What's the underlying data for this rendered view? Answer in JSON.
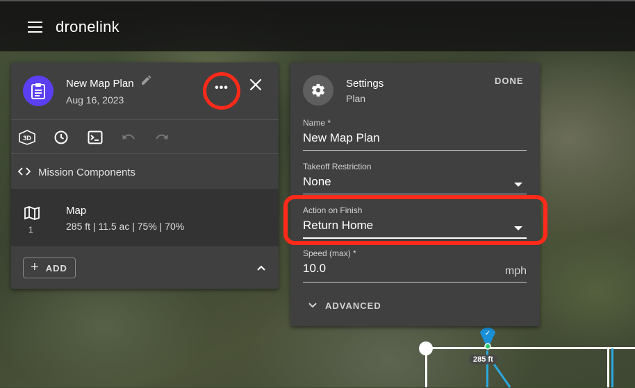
{
  "app": {
    "brand": "dronelink"
  },
  "plan_panel": {
    "title": "New Map Plan",
    "date": "Aug 16, 2023",
    "more_label": "•••",
    "components_label": "Mission Components",
    "component": {
      "title": "Map",
      "details": "285 ft | 11.5 ac | 75% | 70%",
      "count": "1"
    },
    "add_label": "ADD",
    "toolbar_3d_label": "3D"
  },
  "settings_panel": {
    "title": "Settings",
    "subtitle": "Plan",
    "done_label": "DONE",
    "fields": {
      "name": {
        "label": "Name *",
        "value": "New Map Plan"
      },
      "takeoff": {
        "label": "Takeoff Restriction",
        "value": "None"
      },
      "action": {
        "label": "Action on Finish",
        "value": "Return Home"
      },
      "speed": {
        "label": "Speed (max) *",
        "value": "10.0",
        "unit": "mph"
      }
    },
    "advanced_label": "ADVANCED"
  },
  "map": {
    "distance_badge": "285 ft"
  },
  "colors": {
    "accent_purple": "#5b3ff2",
    "highlight_red": "#ff2a1a",
    "panel_bg": "#404040",
    "route_blue": "#2aa9e0"
  },
  "icons": [
    "menu-icon",
    "edit-icon",
    "more-icon",
    "close-icon",
    "3d-view-icon",
    "history-icon",
    "terminal-icon",
    "undo-icon",
    "redo-icon",
    "code-icon",
    "map-icon",
    "plus-icon",
    "chevron-up-icon",
    "gear-icon",
    "caret-down-icon",
    "chevron-down-icon",
    "location-pin-icon"
  ]
}
